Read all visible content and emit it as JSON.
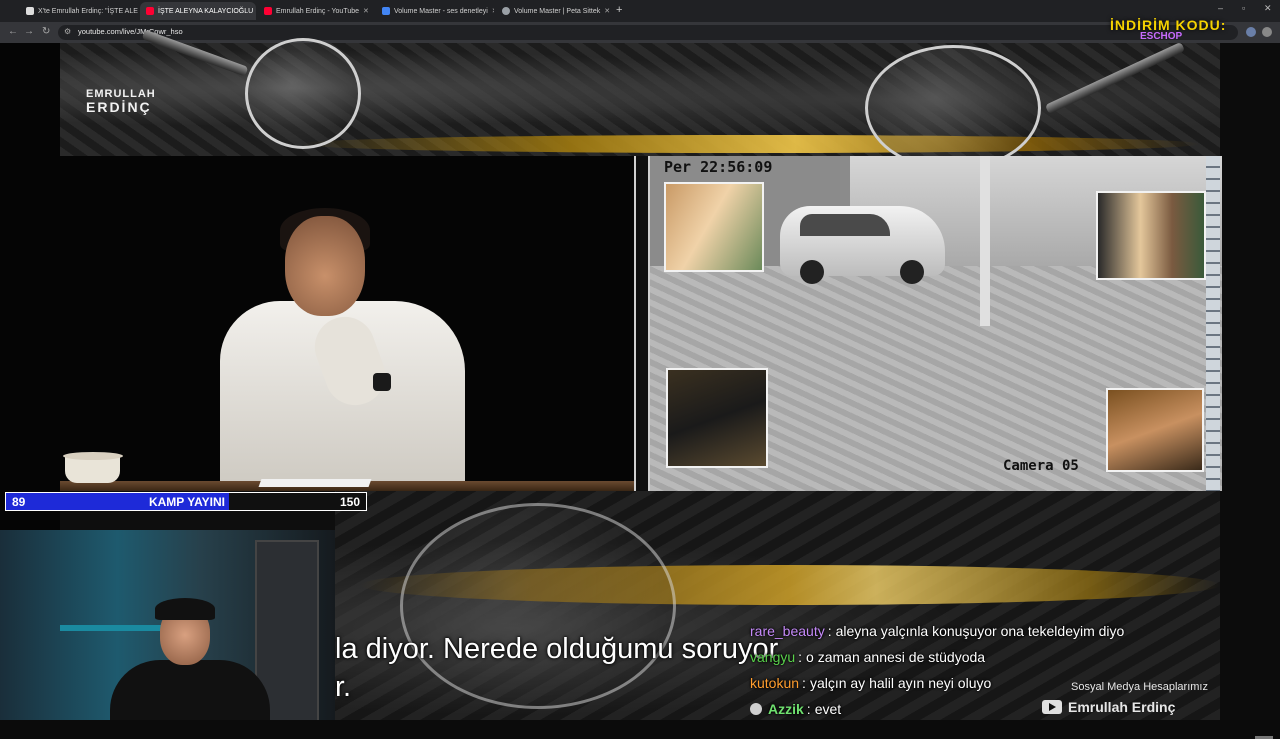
{
  "browser": {
    "tabs": [
      {
        "label": "X'te Emrullah Erdinç: \"İŞTE ALE",
        "color": "#ffffff",
        "icon": "x-logo-icon"
      },
      {
        "label": "İŞTE ALEYNA KALAYCIOĞLU",
        "color": "#ff0033",
        "icon": "youtube-icon",
        "active": true
      },
      {
        "label": "Emrullah Erdinç - YouTube",
        "color": "#ff0033",
        "icon": "youtube-icon"
      },
      {
        "label": "Volume Master - ses denetleyi",
        "color": "#4285f4",
        "icon": "extension-icon"
      },
      {
        "label": "Volume Master | Peta Sittek",
        "color": "#9aa0a6",
        "icon": "globe-icon"
      }
    ],
    "url": "youtube.com/live/JMrCowr_hso"
  },
  "overlay": {
    "logo_line1": "EMRULLAH",
    "logo_line2": "ERDİNÇ",
    "promo_line1": "İNDİRİM KODU:",
    "promo_line2": "ESCHOP",
    "cctv_timestamp": "Per 22:56:09",
    "cctv_camera": "Camera 05",
    "score_left": "89",
    "score_title": "KAMP YAYINI",
    "score_right": "150",
    "score_fraction": 0.62,
    "subtitle_line1": "la diyor. Nerede olduğumu soruyor",
    "subtitle_line2": "r.",
    "social_label": "Sosyal Medya Hesaplarımız",
    "social_channel": "Emrullah Erdinç"
  },
  "chat": [
    {
      "user": "rare_beauty",
      "color": "#c58af9",
      "text": "aleyna yalçınla konuşuyor ona tekeldeyim diyo"
    },
    {
      "user": "vangyu",
      "color": "#59d14b",
      "text": "o zaman annesi de stüdyoda"
    },
    {
      "user": "kutokun",
      "color": "#ff9d2e",
      "text": "yalçın ay halil ayın neyi oluyo"
    },
    {
      "user": "Azzik",
      "color": "#6fe06f",
      "text": "evet",
      "badge": true
    }
  ]
}
